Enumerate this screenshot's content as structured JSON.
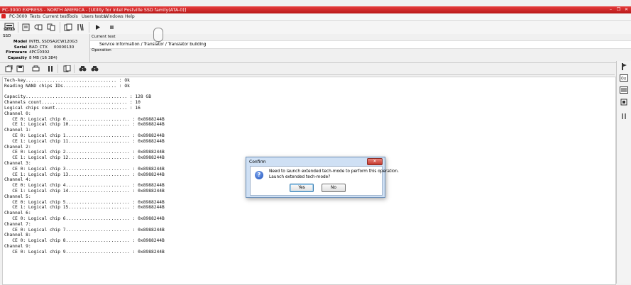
{
  "window": {
    "title": "PC-3000 EXPRESS - NORTH AMERICA - [Utility for Intel Postville SSD family(ATA-0)]",
    "controls": [
      "–",
      "❐",
      "✕"
    ]
  },
  "menubar": {
    "items": [
      "PC-3000",
      "Tests",
      "Current test",
      "Tools",
      "Users tests",
      "Windows",
      "Help"
    ]
  },
  "toolbar": {
    "port_label": "SATA0",
    "icons": [
      "port-icon",
      "drive-icon",
      "tasks-icon",
      "copy-icon",
      "open-icon",
      "tools-icon",
      "play-icon",
      "stop-icon"
    ]
  },
  "drive_info": {
    "type_label": "SSD",
    "fields": [
      {
        "label": "Model",
        "value": "INTEL SSDSA2CW120G3"
      },
      {
        "label": "Serial",
        "value": "BAD_CTX     00000130"
      },
      {
        "label": "Firmware",
        "value": "4PC10302"
      },
      {
        "label": "Capacity",
        "value": "8 MB (16 384)"
      }
    ]
  },
  "current_test": {
    "header": "Current test",
    "path": "Service information / Translator / Translator building",
    "operation_label": "Operation"
  },
  "log": {
    "lines": [
      "Tech-key.................................. : Ok",
      "Reading NAND chips IDs.................... : Ok",
      "",
      "Capacity...................................... : 128 GB",
      "Channels count................................ : 10",
      "Logical chips count........................... : 16",
      "Channel 0:",
      "   CE 0: Logical chip 0........................ : 0x8988244B",
      "   CE 1: Logical chip 10....................... : 0x8988244B",
      "Channel 1:",
      "   CE 0: Logical chip 1........................ : 0x8988244B",
      "   CE 1: Logical chip 11....................... : 0x8988244B",
      "Channel 2:",
      "   CE 0: Logical chip 2........................ : 0x8988244B",
      "   CE 1: Logical chip 12....................... : 0x8988244B",
      "Channel 3:",
      "   CE 0: Logical chip 3........................ : 0x8988244B",
      "   CE 1: Logical chip 13....................... : 0x8988244B",
      "Channel 4:",
      "   CE 0: Logical chip 4........................ : 0x8988244B",
      "   CE 1: Logical chip 14....................... : 0x8988244B",
      "Channel 5:",
      "   CE 0: Logical chip 5........................ : 0x8988244B",
      "   CE 1: Logical chip 15....................... : 0x8988244B",
      "Channel 6:",
      "   CE 0: Logical chip 6........................ : 0x8988244B",
      "Channel 7:",
      "   CE 0: Logical chip 7........................ : 0x8988244B",
      "Channel 8:",
      "   CE 0: Logical chip 8........................ : 0x8988244B",
      "Channel 9:",
      "   CE 0: Logical chip 9........................ : 0x8988244B"
    ]
  },
  "dialog": {
    "title": "Confirm",
    "close_glyph": "✕",
    "message_line1": "Need to launch extended tech-mode to perform this operation.",
    "message_line2": "Launch extended tech-mode?",
    "icon_glyph": "?",
    "yes_label": "Yes",
    "no_label": "No"
  },
  "colors": {
    "titlebar": "#c82020",
    "dialog_frame": "#cfe0f4"
  }
}
